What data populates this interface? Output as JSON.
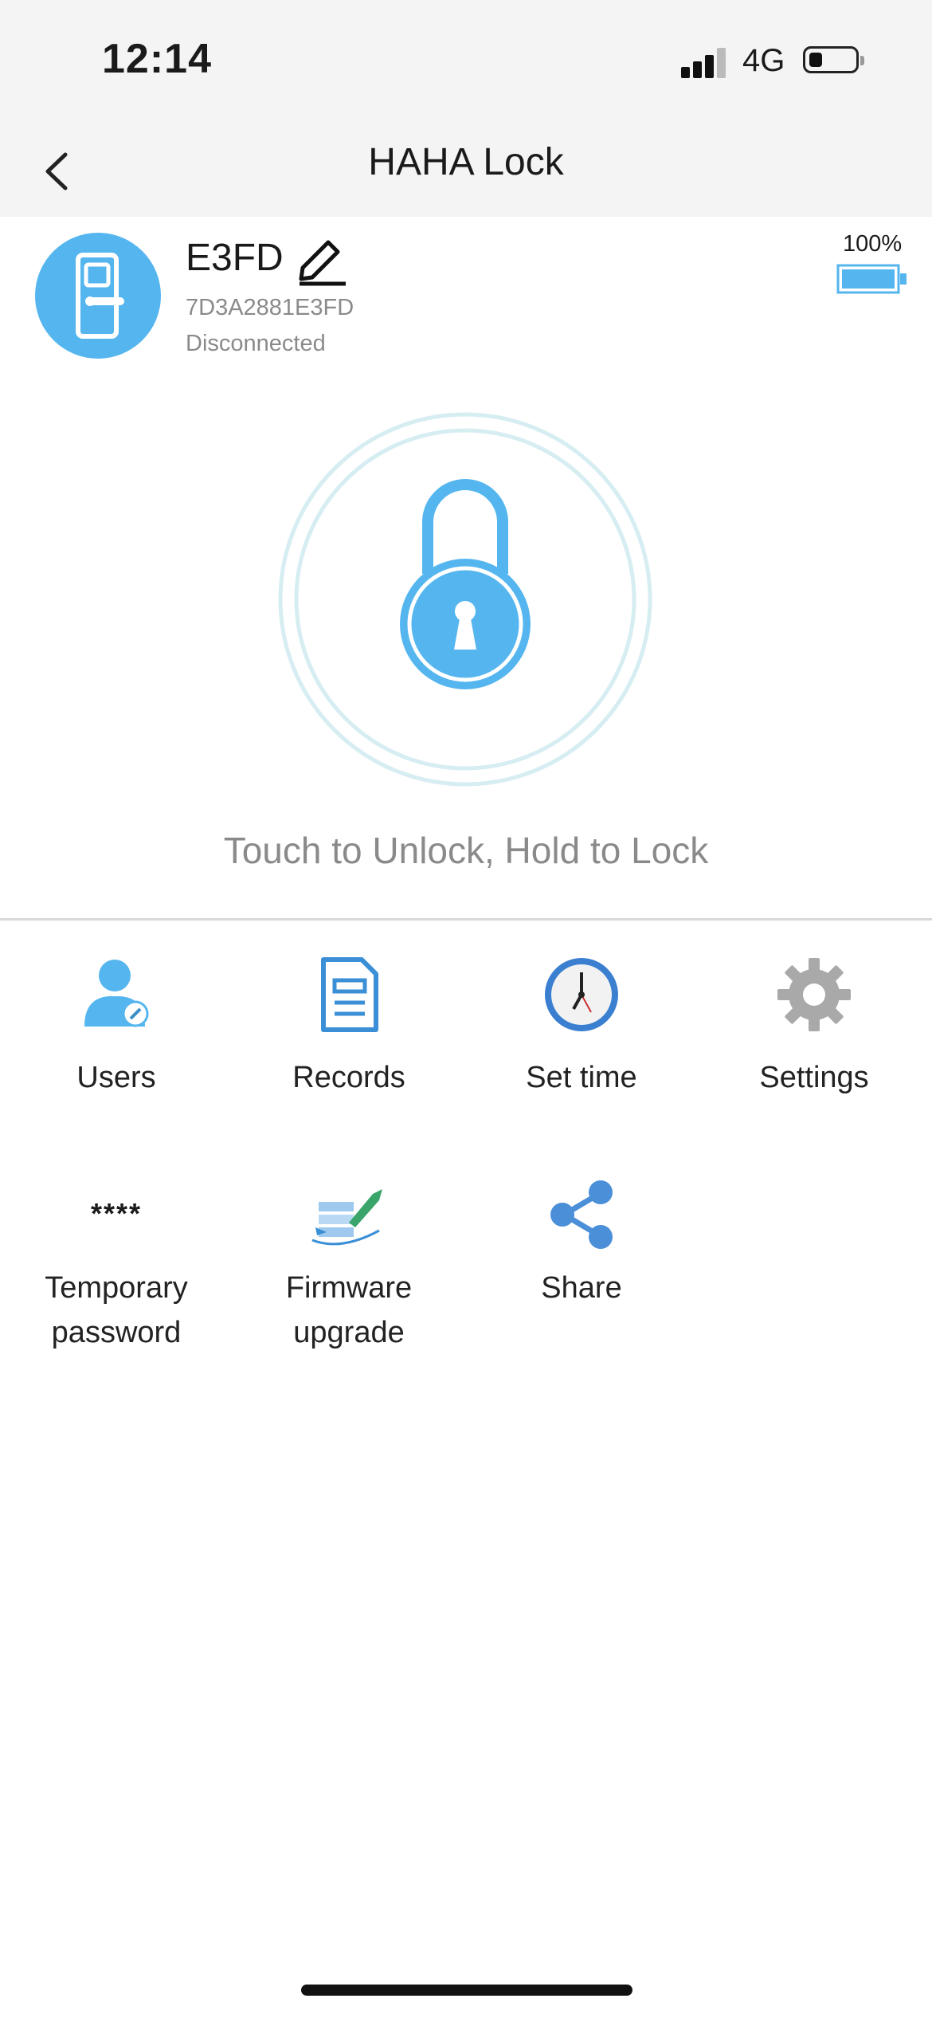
{
  "status_bar": {
    "time": "12:14",
    "network": "4G"
  },
  "nav": {
    "title": "HAHA Lock"
  },
  "lock": {
    "name": "E3FD",
    "mac": "7D3A2881E3FD",
    "connection_status": "Disconnected",
    "battery_percent_label": "100%",
    "battery_level": 1.0
  },
  "hint": "Touch to Unlock, Hold to Lock",
  "menu": {
    "users": "Users",
    "records": "Records",
    "set_time": "Set time",
    "settings": "Settings",
    "temporary_password_icon_text": "****",
    "temporary_password_line1": "Temporary",
    "temporary_password_line2": "password",
    "firmware_line1": "Firmware",
    "firmware_line2": "upgrade",
    "share": "Share"
  },
  "colors": {
    "accent": "#55b6ef",
    "ring": "#d6edf2",
    "text_muted": "#8a8a8a"
  },
  "icons": [
    "back-chevron-icon",
    "edit-pencil-icon",
    "door-lock-icon",
    "battery-icon",
    "padlock-icon",
    "user-icon",
    "document-icon",
    "clock-icon",
    "gear-icon",
    "rocket-icon",
    "share-icon"
  ]
}
